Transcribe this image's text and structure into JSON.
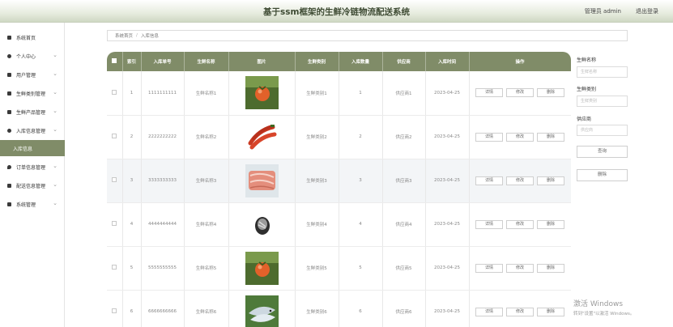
{
  "header": {
    "title": "基于ssm框架的生鲜冷链物流配送系统",
    "user": "管理员 admin",
    "logout": "退出登录"
  },
  "sidebar": {
    "items": [
      {
        "label": "系统首页",
        "icon": "home-icon",
        "has_children": false
      },
      {
        "label": "个人中心",
        "icon": "user-icon",
        "has_children": true
      },
      {
        "label": "用户管理",
        "icon": "monitor-icon",
        "has_children": true
      },
      {
        "label": "生鲜类别管理",
        "icon": "grid-icon",
        "has_children": true
      },
      {
        "label": "生鲜产品管理",
        "icon": "monitor-icon",
        "has_children": true
      },
      {
        "label": "入库信息管理",
        "icon": "user-icon",
        "has_children": true,
        "expanded": true
      },
      {
        "label": "订单信息管理",
        "icon": "pin-icon",
        "has_children": true
      },
      {
        "label": "配送信息管理",
        "icon": "grid-icon",
        "has_children": true
      },
      {
        "label": "系统管理",
        "icon": "check-icon",
        "has_children": true
      }
    ],
    "active_sub": "入库信息"
  },
  "breadcrumb": {
    "home": "系统首页",
    "sep": "/",
    "current": "入库信息"
  },
  "table": {
    "headers": [
      "索引",
      "入库单号",
      "生鲜名称",
      "图片",
      "生鲜类别",
      "入库数量",
      "供应商",
      "入库时间",
      "操作"
    ],
    "actions": [
      "详情",
      "修改",
      "删除"
    ],
    "rows": [
      {
        "index": "1",
        "no": "1111111111",
        "name": "生鲜名称1",
        "image": "tomato",
        "category": "生鲜类别1",
        "qty": "1",
        "supplier": "供应商1",
        "time": "2023-04-25"
      },
      {
        "index": "2",
        "no": "2222222222",
        "name": "生鲜名称2",
        "image": "chili",
        "category": "生鲜类别2",
        "qty": "2",
        "supplier": "供应商2",
        "time": "2023-04-25"
      },
      {
        "index": "3",
        "no": "3333333333",
        "name": "生鲜名称3",
        "image": "meat",
        "category": "生鲜类别3",
        "qty": "3",
        "supplier": "供应商3",
        "time": "2023-04-25"
      },
      {
        "index": "4",
        "no": "4444444444",
        "name": "生鲜名称4",
        "image": "can",
        "category": "生鲜类别4",
        "qty": "4",
        "supplier": "供应商4",
        "time": "2023-04-25"
      },
      {
        "index": "5",
        "no": "5555555555",
        "name": "生鲜名称5",
        "image": "tomato",
        "category": "生鲜类别5",
        "qty": "5",
        "supplier": "供应商5",
        "time": "2023-04-25"
      },
      {
        "index": "6",
        "no": "6666666666",
        "name": "生鲜名称6",
        "image": "fish",
        "category": "生鲜类别6",
        "qty": "6",
        "supplier": "供应商6",
        "time": "2023-04-25"
      }
    ]
  },
  "filters": {
    "name_label": "生鲜名称",
    "name_placeholder": "生鲜名称",
    "category_label": "生鲜类别",
    "category_placeholder": "生鲜类别",
    "supplier_label": "供应商",
    "supplier_placeholder": "供应商",
    "query": "查询",
    "delete": "删除"
  },
  "watermark": {
    "line1": "激活 Windows",
    "line2": "转到\"设置\"以激活 Windows。"
  },
  "colors": {
    "accent": "#808c68",
    "header_bg": "#e7ecdf"
  }
}
